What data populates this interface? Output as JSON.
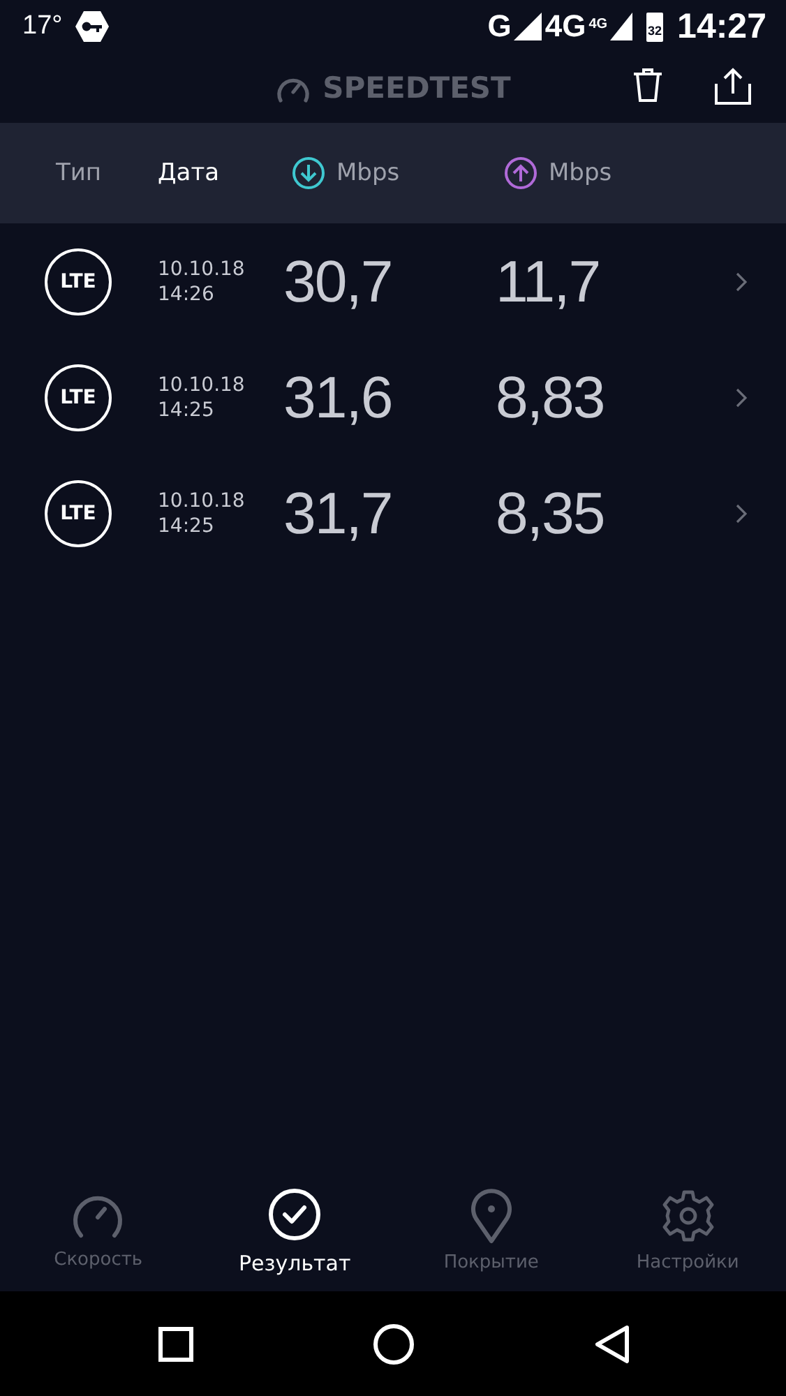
{
  "status_bar": {
    "temperature": "17°",
    "network_1": "G",
    "network_2": "4G",
    "network_2_badge": "4G",
    "battery": "32",
    "time": "14:27"
  },
  "app_bar": {
    "title": "SPEEDTEST"
  },
  "columns": [
    {
      "kind": "type",
      "label": "Тип",
      "selected": false
    },
    {
      "kind": "date",
      "label": "Дата",
      "selected": true
    },
    {
      "kind": "download",
      "label": "Mbps",
      "selected": false,
      "color": "#3fc8d0"
    },
    {
      "kind": "upload",
      "label": "Mbps",
      "selected": false,
      "color": "#b06ad8"
    }
  ],
  "results": [
    {
      "type": "LTE",
      "date": "10.10.18",
      "time": "14:26",
      "download": "30,7",
      "upload": "11,7"
    },
    {
      "type": "LTE",
      "date": "10.10.18",
      "time": "14:25",
      "download": "31,6",
      "upload": "8,83"
    },
    {
      "type": "LTE",
      "date": "10.10.18",
      "time": "14:25",
      "download": "31,7",
      "upload": "8,35"
    }
  ],
  "bottom_tabs": [
    {
      "kind": "speed",
      "label": "Скорость",
      "selected": false
    },
    {
      "kind": "results",
      "label": "Результат",
      "selected": true
    },
    {
      "kind": "coverage",
      "label": "Покрытие",
      "selected": false
    },
    {
      "kind": "settings",
      "label": "Настройки",
      "selected": false
    }
  ]
}
